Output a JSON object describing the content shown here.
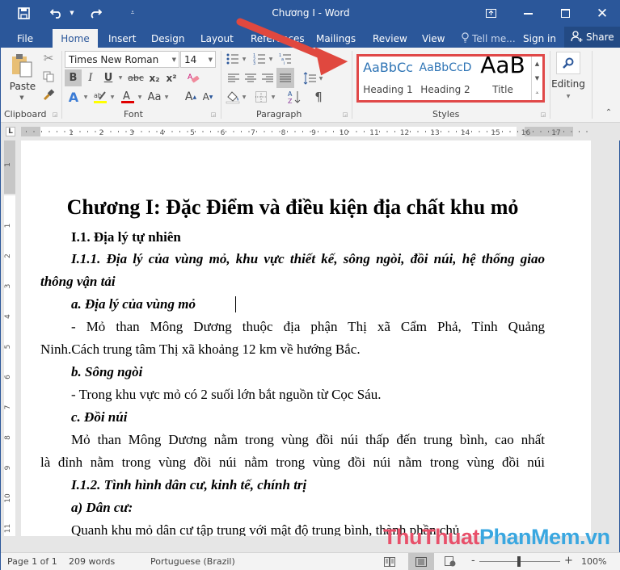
{
  "window": {
    "title": "Chương I - Word",
    "accent": "#2b579a",
    "highlight_color": "#e04848"
  },
  "qat": {
    "save_icon": "save-icon",
    "undo_icon": "undo-icon",
    "redo_icon": "redo-icon",
    "customize_icon": "customize-qat-icon"
  },
  "tabs": [
    {
      "label": "File"
    },
    {
      "label": "Home",
      "active": true
    },
    {
      "label": "Insert"
    },
    {
      "label": "Design"
    },
    {
      "label": "Layout"
    },
    {
      "label": "References"
    },
    {
      "label": "Mailings"
    },
    {
      "label": "Review"
    },
    {
      "label": "View"
    }
  ],
  "tell_me": "Tell me...",
  "sign_in": "Sign in",
  "share": "Share",
  "ribbon": {
    "clipboard": {
      "label": "Clipboard",
      "paste": "Paste"
    },
    "font": {
      "label": "Font",
      "font_name": "Times New Roman",
      "font_size": "14",
      "bold": "B",
      "italic": "I",
      "underline": "U",
      "strike": "abc",
      "subscript": "x₂",
      "superscript": "x²",
      "change_case": "Aa",
      "grow": "A",
      "shrink": "A"
    },
    "paragraph": {
      "label": "Paragraph",
      "pilcrow": "¶"
    },
    "styles": {
      "label": "Styles",
      "items": [
        {
          "preview": "AaBbCc",
          "name": "Heading 1"
        },
        {
          "preview": "AaBbCcD",
          "name": "Heading 2"
        },
        {
          "preview": "AaB",
          "name": "Title"
        }
      ]
    },
    "editing": {
      "label": "Editing"
    }
  },
  "ruler": {
    "h_ticks": [
      "1",
      "2",
      "3",
      "4",
      "5",
      "6",
      "7",
      "8",
      "9",
      "10",
      "11",
      "12",
      "13",
      "14",
      "15",
      "16",
      "17"
    ],
    "v_ticks": [
      "1",
      "1",
      "2",
      "3",
      "4",
      "5",
      "6",
      "7",
      "8",
      "9",
      "10",
      "11"
    ]
  },
  "document": {
    "title": "Chương I: Đặc Điểm và điều kiện địa chất khu mỏ",
    "lines": [
      {
        "text": "I.1. Địa lý tự  nhiên",
        "style": "bold",
        "indent": true
      },
      {
        "text": "I.1.1. Địa lý của vùng mỏ, khu vực thiết kế, sông ngòi, đồi núi, hệ thống giao",
        "style": "bolditalic",
        "indent": true
      },
      {
        "text": "thông vận tải",
        "style": "bolditalic",
        "indent": false
      },
      {
        "text": "a. Địa lý của vùng mỏ",
        "style": "bolditalic",
        "indent": true
      },
      {
        "text": "- Mỏ than Mông Dương thuộc địa phận Thị xã Cẩm Phả, Tỉnh Quảng",
        "style": "justify",
        "indent": true
      },
      {
        "text": "Ninh.Cách trung tâm Thị xã khoảng 12 km về hướng Bắc.",
        "style": "normal",
        "indent": false
      },
      {
        "text": "b. Sông ngòi",
        "style": "bolditalic",
        "indent": true
      },
      {
        "text": "- Trong khu vực mỏ có 2 suối lớn bắt nguồn từ Cọc Sáu.",
        "style": "normal",
        "indent": true
      },
      {
        "text": "c. Đồi núi",
        "style": "bolditalic",
        "indent": true
      },
      {
        "text": " Mỏ than Mông Dương nằm trong vùng đồi núi thấp đến trung bình, cao nhất",
        "style": "normal",
        "indent": true
      },
      {
        "text": "là đỉnh nằm trong vùng đồi núi nằm trong vùng đồi núi nằm trong vùng đồi núi",
        "style": "normal",
        "indent": false
      },
      {
        "text": "I.1.2.  Tình hình dân cư, kinh tế, chính trị",
        "style": "bolditalic",
        "indent": true
      },
      {
        "text": "a) Dân cư:",
        "style": "bolditalic",
        "indent": true
      },
      {
        "text": " Quanh khu mỏ dân cư tập trung với mật độ trung bình, thành phần chủ",
        "style": "normal",
        "indent": true
      }
    ]
  },
  "statusbar": {
    "page": "Page 1 of 1",
    "words": "209 words",
    "language": "Portuguese (Brazil)",
    "zoom": "100%",
    "zoom_minus": "-",
    "zoom_plus": "+"
  },
  "watermark": {
    "part1": "ThuThuat",
    "part2": "PhanMem.vn",
    "color1": "#e8506a",
    "color2": "#3aa7e0"
  }
}
